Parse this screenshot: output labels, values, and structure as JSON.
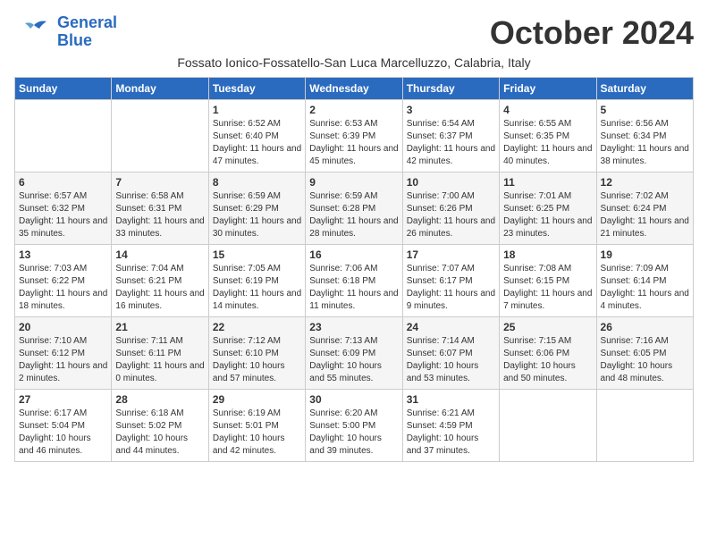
{
  "header": {
    "logo_line1": "General",
    "logo_line2": "Blue",
    "month_title": "October 2024",
    "subtitle": "Fossato Ionico-Fossatello-San Luca Marcelluzzo, Calabria, Italy"
  },
  "days_of_week": [
    "Sunday",
    "Monday",
    "Tuesday",
    "Wednesday",
    "Thursday",
    "Friday",
    "Saturday"
  ],
  "weeks": [
    [
      {
        "day": "",
        "info": ""
      },
      {
        "day": "",
        "info": ""
      },
      {
        "day": "1",
        "info": "Sunrise: 6:52 AM\nSunset: 6:40 PM\nDaylight: 11 hours and 47 minutes."
      },
      {
        "day": "2",
        "info": "Sunrise: 6:53 AM\nSunset: 6:39 PM\nDaylight: 11 hours and 45 minutes."
      },
      {
        "day": "3",
        "info": "Sunrise: 6:54 AM\nSunset: 6:37 PM\nDaylight: 11 hours and 42 minutes."
      },
      {
        "day": "4",
        "info": "Sunrise: 6:55 AM\nSunset: 6:35 PM\nDaylight: 11 hours and 40 minutes."
      },
      {
        "day": "5",
        "info": "Sunrise: 6:56 AM\nSunset: 6:34 PM\nDaylight: 11 hours and 38 minutes."
      }
    ],
    [
      {
        "day": "6",
        "info": "Sunrise: 6:57 AM\nSunset: 6:32 PM\nDaylight: 11 hours and 35 minutes."
      },
      {
        "day": "7",
        "info": "Sunrise: 6:58 AM\nSunset: 6:31 PM\nDaylight: 11 hours and 33 minutes."
      },
      {
        "day": "8",
        "info": "Sunrise: 6:59 AM\nSunset: 6:29 PM\nDaylight: 11 hours and 30 minutes."
      },
      {
        "day": "9",
        "info": "Sunrise: 6:59 AM\nSunset: 6:28 PM\nDaylight: 11 hours and 28 minutes."
      },
      {
        "day": "10",
        "info": "Sunrise: 7:00 AM\nSunset: 6:26 PM\nDaylight: 11 hours and 26 minutes."
      },
      {
        "day": "11",
        "info": "Sunrise: 7:01 AM\nSunset: 6:25 PM\nDaylight: 11 hours and 23 minutes."
      },
      {
        "day": "12",
        "info": "Sunrise: 7:02 AM\nSunset: 6:24 PM\nDaylight: 11 hours and 21 minutes."
      }
    ],
    [
      {
        "day": "13",
        "info": "Sunrise: 7:03 AM\nSunset: 6:22 PM\nDaylight: 11 hours and 18 minutes."
      },
      {
        "day": "14",
        "info": "Sunrise: 7:04 AM\nSunset: 6:21 PM\nDaylight: 11 hours and 16 minutes."
      },
      {
        "day": "15",
        "info": "Sunrise: 7:05 AM\nSunset: 6:19 PM\nDaylight: 11 hours and 14 minutes."
      },
      {
        "day": "16",
        "info": "Sunrise: 7:06 AM\nSunset: 6:18 PM\nDaylight: 11 hours and 11 minutes."
      },
      {
        "day": "17",
        "info": "Sunrise: 7:07 AM\nSunset: 6:17 PM\nDaylight: 11 hours and 9 minutes."
      },
      {
        "day": "18",
        "info": "Sunrise: 7:08 AM\nSunset: 6:15 PM\nDaylight: 11 hours and 7 minutes."
      },
      {
        "day": "19",
        "info": "Sunrise: 7:09 AM\nSunset: 6:14 PM\nDaylight: 11 hours and 4 minutes."
      }
    ],
    [
      {
        "day": "20",
        "info": "Sunrise: 7:10 AM\nSunset: 6:12 PM\nDaylight: 11 hours and 2 minutes."
      },
      {
        "day": "21",
        "info": "Sunrise: 7:11 AM\nSunset: 6:11 PM\nDaylight: 11 hours and 0 minutes."
      },
      {
        "day": "22",
        "info": "Sunrise: 7:12 AM\nSunset: 6:10 PM\nDaylight: 10 hours and 57 minutes."
      },
      {
        "day": "23",
        "info": "Sunrise: 7:13 AM\nSunset: 6:09 PM\nDaylight: 10 hours and 55 minutes."
      },
      {
        "day": "24",
        "info": "Sunrise: 7:14 AM\nSunset: 6:07 PM\nDaylight: 10 hours and 53 minutes."
      },
      {
        "day": "25",
        "info": "Sunrise: 7:15 AM\nSunset: 6:06 PM\nDaylight: 10 hours and 50 minutes."
      },
      {
        "day": "26",
        "info": "Sunrise: 7:16 AM\nSunset: 6:05 PM\nDaylight: 10 hours and 48 minutes."
      }
    ],
    [
      {
        "day": "27",
        "info": "Sunrise: 6:17 AM\nSunset: 5:04 PM\nDaylight: 10 hours and 46 minutes."
      },
      {
        "day": "28",
        "info": "Sunrise: 6:18 AM\nSunset: 5:02 PM\nDaylight: 10 hours and 44 minutes."
      },
      {
        "day": "29",
        "info": "Sunrise: 6:19 AM\nSunset: 5:01 PM\nDaylight: 10 hours and 42 minutes."
      },
      {
        "day": "30",
        "info": "Sunrise: 6:20 AM\nSunset: 5:00 PM\nDaylight: 10 hours and 39 minutes."
      },
      {
        "day": "31",
        "info": "Sunrise: 6:21 AM\nSunset: 4:59 PM\nDaylight: 10 hours and 37 minutes."
      },
      {
        "day": "",
        "info": ""
      },
      {
        "day": "",
        "info": ""
      }
    ]
  ]
}
